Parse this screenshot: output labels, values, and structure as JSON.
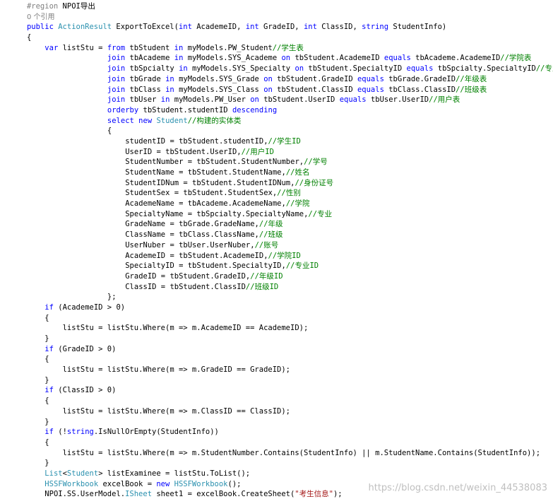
{
  "colors": {
    "keyword": "#0000ff",
    "type": "#2b91af",
    "comment": "#008000",
    "string": "#a31515",
    "gray": "#808080",
    "plain": "#000000"
  },
  "watermark": "https://blog.csdn.net/weixin_44538083",
  "lines": [
    {
      "indent": 6,
      "name": "region-line",
      "tokens": [
        {
          "c": "gr",
          "t": "#region "
        },
        {
          "c": "",
          "t": "NPOI导出"
        }
      ]
    },
    {
      "indent": 6,
      "name": "codelens-references",
      "codelens": true,
      "tokens": [
        {
          "c": "",
          "t": "0 个引用"
        }
      ]
    },
    {
      "indent": 6,
      "name": "method-signature-line",
      "tokens": [
        {
          "c": "kw",
          "t": "public "
        },
        {
          "c": "ty",
          "t": "ActionResult"
        },
        {
          "c": "",
          "t": " ExportToExcel("
        },
        {
          "c": "kw",
          "t": "int"
        },
        {
          "c": "",
          "t": " AcademeID, "
        },
        {
          "c": "kw",
          "t": "int"
        },
        {
          "c": "",
          "t": " GradeID, "
        },
        {
          "c": "kw",
          "t": "int"
        },
        {
          "c": "",
          "t": " ClassID, "
        },
        {
          "c": "kw",
          "t": "string"
        },
        {
          "c": "",
          "t": " StudentInfo)"
        }
      ]
    },
    {
      "indent": 6,
      "name": "code-line",
      "tokens": [
        {
          "c": "",
          "t": "{"
        }
      ]
    },
    {
      "indent": 10,
      "name": "code-line",
      "tokens": [
        {
          "c": "kw",
          "t": "var"
        },
        {
          "c": "",
          "t": " listStu = "
        },
        {
          "c": "kw",
          "t": "from"
        },
        {
          "c": "",
          "t": " tbStudent "
        },
        {
          "c": "kw",
          "t": "in"
        },
        {
          "c": "",
          "t": " myModels.PW_Student"
        },
        {
          "c": "cm",
          "t": "//学生表"
        }
      ]
    },
    {
      "indent": 24,
      "name": "code-line",
      "tokens": [
        {
          "c": "kw",
          "t": "join"
        },
        {
          "c": "",
          "t": " tbAcademe "
        },
        {
          "c": "kw",
          "t": "in"
        },
        {
          "c": "",
          "t": " myModels.SYS_Academe "
        },
        {
          "c": "kw",
          "t": "on"
        },
        {
          "c": "",
          "t": " tbStudent.AcademeID "
        },
        {
          "c": "kw",
          "t": "equals"
        },
        {
          "c": "",
          "t": " tbAcademe.AcademeID"
        },
        {
          "c": "cm",
          "t": "//学院表"
        }
      ]
    },
    {
      "indent": 24,
      "name": "code-line",
      "tokens": [
        {
          "c": "kw",
          "t": "join"
        },
        {
          "c": "",
          "t": " tbSpcialty "
        },
        {
          "c": "kw",
          "t": "in"
        },
        {
          "c": "",
          "t": " myModels.SYS_Specialty "
        },
        {
          "c": "kw",
          "t": "on"
        },
        {
          "c": "",
          "t": " tbStudent.SpecialtyID "
        },
        {
          "c": "kw",
          "t": "equals"
        },
        {
          "c": "",
          "t": " tbSpcialty.SpecialtyID"
        },
        {
          "c": "cm",
          "t": "//专业表"
        }
      ]
    },
    {
      "indent": 24,
      "name": "code-line",
      "tokens": [
        {
          "c": "kw",
          "t": "join"
        },
        {
          "c": "",
          "t": " tbGrade "
        },
        {
          "c": "kw",
          "t": "in"
        },
        {
          "c": "",
          "t": " myModels.SYS_Grade "
        },
        {
          "c": "kw",
          "t": "on"
        },
        {
          "c": "",
          "t": " tbStudent.GradeID "
        },
        {
          "c": "kw",
          "t": "equals"
        },
        {
          "c": "",
          "t": " tbGrade.GradeID"
        },
        {
          "c": "cm",
          "t": "//年级表"
        }
      ]
    },
    {
      "indent": 24,
      "name": "code-line",
      "tokens": [
        {
          "c": "kw",
          "t": "join"
        },
        {
          "c": "",
          "t": " tbClass "
        },
        {
          "c": "kw",
          "t": "in"
        },
        {
          "c": "",
          "t": " myModels.SYS_Class "
        },
        {
          "c": "kw",
          "t": "on"
        },
        {
          "c": "",
          "t": " tbStudent.ClassID "
        },
        {
          "c": "kw",
          "t": "equals"
        },
        {
          "c": "",
          "t": " tbClass.ClassID"
        },
        {
          "c": "cm",
          "t": "//班级表"
        }
      ]
    },
    {
      "indent": 24,
      "name": "code-line",
      "tokens": [
        {
          "c": "kw",
          "t": "join"
        },
        {
          "c": "",
          "t": " tbUser "
        },
        {
          "c": "kw",
          "t": "in"
        },
        {
          "c": "",
          "t": " myModels.PW_User "
        },
        {
          "c": "kw",
          "t": "on"
        },
        {
          "c": "",
          "t": " tbStudent.UserID "
        },
        {
          "c": "kw",
          "t": "equals"
        },
        {
          "c": "",
          "t": " tbUser.UserID"
        },
        {
          "c": "cm",
          "t": "//用户表"
        }
      ]
    },
    {
      "indent": 24,
      "name": "code-line",
      "tokens": [
        {
          "c": "kw",
          "t": "orderby"
        },
        {
          "c": "",
          "t": " tbStudent.studentID "
        },
        {
          "c": "kw",
          "t": "descending"
        }
      ]
    },
    {
      "indent": 24,
      "name": "code-line",
      "tokens": [
        {
          "c": "kw",
          "t": "select"
        },
        {
          "c": "",
          "t": " "
        },
        {
          "c": "kw",
          "t": "new"
        },
        {
          "c": "",
          "t": " "
        },
        {
          "c": "ty",
          "t": "Student"
        },
        {
          "c": "cm",
          "t": "//构建的实体类"
        }
      ]
    },
    {
      "indent": 24,
      "name": "code-line",
      "tokens": [
        {
          "c": "",
          "t": "{"
        }
      ]
    },
    {
      "indent": 28,
      "name": "code-line",
      "tokens": [
        {
          "c": "",
          "t": "studentID = tbStudent.studentID,"
        },
        {
          "c": "cm",
          "t": "//学生ID"
        }
      ]
    },
    {
      "indent": 28,
      "name": "code-line",
      "tokens": [
        {
          "c": "",
          "t": "UserID = tbStudent.UserID,"
        },
        {
          "c": "cm",
          "t": "//用户ID"
        }
      ]
    },
    {
      "indent": 28,
      "name": "code-line",
      "tokens": [
        {
          "c": "",
          "t": "StudentNumber = tbStudent.StudentNumber,"
        },
        {
          "c": "cm",
          "t": "//学号"
        }
      ]
    },
    {
      "indent": 28,
      "name": "code-line",
      "tokens": [
        {
          "c": "",
          "t": "StudentName = tbStudent.StudentName,"
        },
        {
          "c": "cm",
          "t": "//姓名"
        }
      ]
    },
    {
      "indent": 28,
      "name": "code-line",
      "tokens": [
        {
          "c": "",
          "t": "StudentIDNum = tbStudent.StudentIDNum,"
        },
        {
          "c": "cm",
          "t": "//身份证号"
        }
      ]
    },
    {
      "indent": 28,
      "name": "code-line",
      "tokens": [
        {
          "c": "",
          "t": "StudentSex = tbStudent.StudentSex,"
        },
        {
          "c": "cm",
          "t": "//性别"
        }
      ]
    },
    {
      "indent": 28,
      "name": "code-line",
      "tokens": [
        {
          "c": "",
          "t": "AcademeName = tbAcademe.AcademeName,"
        },
        {
          "c": "cm",
          "t": "//学院"
        }
      ]
    },
    {
      "indent": 28,
      "name": "code-line",
      "tokens": [
        {
          "c": "",
          "t": "SpecialtyName = tbSpcialty.SpecialtyName,"
        },
        {
          "c": "cm",
          "t": "//专业"
        }
      ]
    },
    {
      "indent": 28,
      "name": "code-line",
      "tokens": [
        {
          "c": "",
          "t": "GradeName = tbGrade.GradeName,"
        },
        {
          "c": "cm",
          "t": "//年级"
        }
      ]
    },
    {
      "indent": 28,
      "name": "code-line",
      "tokens": [
        {
          "c": "",
          "t": "ClassName = tbClass.ClassName,"
        },
        {
          "c": "cm",
          "t": "//班级"
        }
      ]
    },
    {
      "indent": 28,
      "name": "code-line",
      "tokens": [
        {
          "c": "",
          "t": "UserNuber = tbUser.UserNuber,"
        },
        {
          "c": "cm",
          "t": "//账号"
        }
      ]
    },
    {
      "indent": 28,
      "name": "code-line",
      "tokens": [
        {
          "c": "",
          "t": "AcademeID = tbStudent.AcademeID,"
        },
        {
          "c": "cm",
          "t": "//学院ID"
        }
      ]
    },
    {
      "indent": 28,
      "name": "code-line",
      "tokens": [
        {
          "c": "",
          "t": "SpecialtyID = tbStudent.SpecialtyID,"
        },
        {
          "c": "cm",
          "t": "//专业ID"
        }
      ]
    },
    {
      "indent": 28,
      "name": "code-line",
      "tokens": [
        {
          "c": "",
          "t": "GradeID = tbStudent.GradeID,"
        },
        {
          "c": "cm",
          "t": "//年级ID"
        }
      ]
    },
    {
      "indent": 28,
      "name": "code-line",
      "tokens": [
        {
          "c": "",
          "t": "ClassID = tbStudent.ClassID"
        },
        {
          "c": "cm",
          "t": "//班级ID"
        }
      ]
    },
    {
      "indent": 24,
      "name": "code-line",
      "tokens": [
        {
          "c": "",
          "t": "};"
        }
      ]
    },
    {
      "indent": 10,
      "name": "code-line",
      "tokens": [
        {
          "c": "kw",
          "t": "if"
        },
        {
          "c": "",
          "t": " (AcademeID > 0)"
        }
      ]
    },
    {
      "indent": 10,
      "name": "code-line",
      "tokens": [
        {
          "c": "",
          "t": "{"
        }
      ]
    },
    {
      "indent": 14,
      "name": "code-line",
      "tokens": [
        {
          "c": "",
          "t": "listStu = listStu.Where(m => m.AcademeID == AcademeID);"
        }
      ]
    },
    {
      "indent": 10,
      "name": "code-line",
      "tokens": [
        {
          "c": "",
          "t": "}"
        }
      ]
    },
    {
      "indent": 10,
      "name": "code-line",
      "tokens": [
        {
          "c": "kw",
          "t": "if"
        },
        {
          "c": "",
          "t": " (GradeID > 0)"
        }
      ]
    },
    {
      "indent": 10,
      "name": "code-line",
      "tokens": [
        {
          "c": "",
          "t": "{"
        }
      ]
    },
    {
      "indent": 14,
      "name": "code-line",
      "tokens": [
        {
          "c": "",
          "t": "listStu = listStu.Where(m => m.GradeID == GradeID);"
        }
      ]
    },
    {
      "indent": 10,
      "name": "code-line",
      "tokens": [
        {
          "c": "",
          "t": "}"
        }
      ]
    },
    {
      "indent": 10,
      "name": "code-line",
      "tokens": [
        {
          "c": "kw",
          "t": "if"
        },
        {
          "c": "",
          "t": " (ClassID > 0)"
        }
      ]
    },
    {
      "indent": 10,
      "name": "code-line",
      "tokens": [
        {
          "c": "",
          "t": "{"
        }
      ]
    },
    {
      "indent": 14,
      "name": "code-line",
      "tokens": [
        {
          "c": "",
          "t": "listStu = listStu.Where(m => m.ClassID == ClassID);"
        }
      ]
    },
    {
      "indent": 10,
      "name": "code-line",
      "tokens": [
        {
          "c": "",
          "t": "}"
        }
      ]
    },
    {
      "indent": 10,
      "name": "code-line",
      "tokens": [
        {
          "c": "kw",
          "t": "if"
        },
        {
          "c": "",
          "t": " (!"
        },
        {
          "c": "kw",
          "t": "string"
        },
        {
          "c": "",
          "t": ".IsNullOrEmpty(StudentInfo))"
        }
      ]
    },
    {
      "indent": 10,
      "name": "code-line",
      "tokens": [
        {
          "c": "",
          "t": "{"
        }
      ]
    },
    {
      "indent": 14,
      "name": "code-line",
      "tokens": [
        {
          "c": "",
          "t": "listStu = listStu.Where(m => m.StudentNumber.Contains(StudentInfo) || m.StudentName.Contains(StudentInfo));"
        }
      ]
    },
    {
      "indent": 10,
      "name": "code-line",
      "tokens": [
        {
          "c": "",
          "t": "}"
        }
      ]
    },
    {
      "indent": 10,
      "name": "code-line",
      "tokens": [
        {
          "c": "ty",
          "t": "List"
        },
        {
          "c": "",
          "t": "<"
        },
        {
          "c": "ty",
          "t": "Student"
        },
        {
          "c": "",
          "t": "> listExaminee = listStu.ToList();"
        }
      ]
    },
    {
      "indent": 10,
      "name": "code-line",
      "tokens": [
        {
          "c": "ty",
          "t": "HSSFWorkbook"
        },
        {
          "c": "",
          "t": " excelBook = "
        },
        {
          "c": "kw",
          "t": "new"
        },
        {
          "c": "",
          "t": " "
        },
        {
          "c": "ty",
          "t": "HSSFWorkbook"
        },
        {
          "c": "",
          "t": "();"
        }
      ]
    },
    {
      "indent": 10,
      "name": "code-line",
      "tokens": [
        {
          "c": "",
          "t": "NPOI.SS.UserModel."
        },
        {
          "c": "ty",
          "t": "ISheet"
        },
        {
          "c": "",
          "t": " sheet1 = excelBook.CreateSheet("
        },
        {
          "c": "st",
          "t": "\"考生信息\""
        },
        {
          "c": "",
          "t": ");"
        }
      ]
    }
  ]
}
